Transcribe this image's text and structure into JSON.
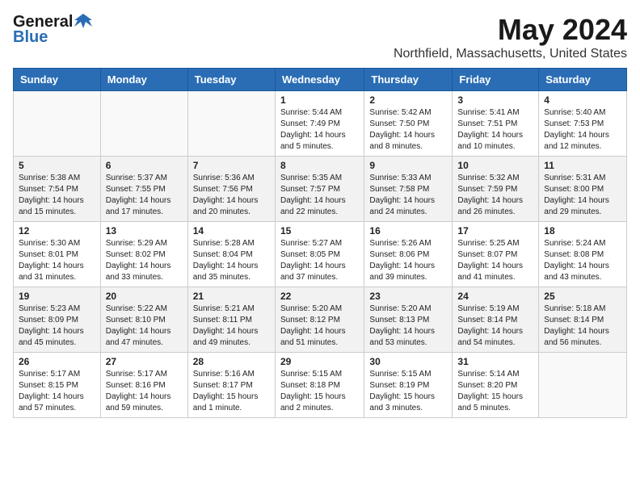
{
  "header": {
    "logo_general": "General",
    "logo_blue": "Blue",
    "month_title": "May 2024",
    "location": "Northfield, Massachusetts, United States"
  },
  "weekdays": [
    "Sunday",
    "Monday",
    "Tuesday",
    "Wednesday",
    "Thursday",
    "Friday",
    "Saturday"
  ],
  "weeks": [
    [
      {
        "day": "",
        "info": ""
      },
      {
        "day": "",
        "info": ""
      },
      {
        "day": "",
        "info": ""
      },
      {
        "day": "1",
        "info": "Sunrise: 5:44 AM\nSunset: 7:49 PM\nDaylight: 14 hours\nand 5 minutes."
      },
      {
        "day": "2",
        "info": "Sunrise: 5:42 AM\nSunset: 7:50 PM\nDaylight: 14 hours\nand 8 minutes."
      },
      {
        "day": "3",
        "info": "Sunrise: 5:41 AM\nSunset: 7:51 PM\nDaylight: 14 hours\nand 10 minutes."
      },
      {
        "day": "4",
        "info": "Sunrise: 5:40 AM\nSunset: 7:53 PM\nDaylight: 14 hours\nand 12 minutes."
      }
    ],
    [
      {
        "day": "5",
        "info": "Sunrise: 5:38 AM\nSunset: 7:54 PM\nDaylight: 14 hours\nand 15 minutes."
      },
      {
        "day": "6",
        "info": "Sunrise: 5:37 AM\nSunset: 7:55 PM\nDaylight: 14 hours\nand 17 minutes."
      },
      {
        "day": "7",
        "info": "Sunrise: 5:36 AM\nSunset: 7:56 PM\nDaylight: 14 hours\nand 20 minutes."
      },
      {
        "day": "8",
        "info": "Sunrise: 5:35 AM\nSunset: 7:57 PM\nDaylight: 14 hours\nand 22 minutes."
      },
      {
        "day": "9",
        "info": "Sunrise: 5:33 AM\nSunset: 7:58 PM\nDaylight: 14 hours\nand 24 minutes."
      },
      {
        "day": "10",
        "info": "Sunrise: 5:32 AM\nSunset: 7:59 PM\nDaylight: 14 hours\nand 26 minutes."
      },
      {
        "day": "11",
        "info": "Sunrise: 5:31 AM\nSunset: 8:00 PM\nDaylight: 14 hours\nand 29 minutes."
      }
    ],
    [
      {
        "day": "12",
        "info": "Sunrise: 5:30 AM\nSunset: 8:01 PM\nDaylight: 14 hours\nand 31 minutes."
      },
      {
        "day": "13",
        "info": "Sunrise: 5:29 AM\nSunset: 8:02 PM\nDaylight: 14 hours\nand 33 minutes."
      },
      {
        "day": "14",
        "info": "Sunrise: 5:28 AM\nSunset: 8:04 PM\nDaylight: 14 hours\nand 35 minutes."
      },
      {
        "day": "15",
        "info": "Sunrise: 5:27 AM\nSunset: 8:05 PM\nDaylight: 14 hours\nand 37 minutes."
      },
      {
        "day": "16",
        "info": "Sunrise: 5:26 AM\nSunset: 8:06 PM\nDaylight: 14 hours\nand 39 minutes."
      },
      {
        "day": "17",
        "info": "Sunrise: 5:25 AM\nSunset: 8:07 PM\nDaylight: 14 hours\nand 41 minutes."
      },
      {
        "day": "18",
        "info": "Sunrise: 5:24 AM\nSunset: 8:08 PM\nDaylight: 14 hours\nand 43 minutes."
      }
    ],
    [
      {
        "day": "19",
        "info": "Sunrise: 5:23 AM\nSunset: 8:09 PM\nDaylight: 14 hours\nand 45 minutes."
      },
      {
        "day": "20",
        "info": "Sunrise: 5:22 AM\nSunset: 8:10 PM\nDaylight: 14 hours\nand 47 minutes."
      },
      {
        "day": "21",
        "info": "Sunrise: 5:21 AM\nSunset: 8:11 PM\nDaylight: 14 hours\nand 49 minutes."
      },
      {
        "day": "22",
        "info": "Sunrise: 5:20 AM\nSunset: 8:12 PM\nDaylight: 14 hours\nand 51 minutes."
      },
      {
        "day": "23",
        "info": "Sunrise: 5:20 AM\nSunset: 8:13 PM\nDaylight: 14 hours\nand 53 minutes."
      },
      {
        "day": "24",
        "info": "Sunrise: 5:19 AM\nSunset: 8:14 PM\nDaylight: 14 hours\nand 54 minutes."
      },
      {
        "day": "25",
        "info": "Sunrise: 5:18 AM\nSunset: 8:14 PM\nDaylight: 14 hours\nand 56 minutes."
      }
    ],
    [
      {
        "day": "26",
        "info": "Sunrise: 5:17 AM\nSunset: 8:15 PM\nDaylight: 14 hours\nand 57 minutes."
      },
      {
        "day": "27",
        "info": "Sunrise: 5:17 AM\nSunset: 8:16 PM\nDaylight: 14 hours\nand 59 minutes."
      },
      {
        "day": "28",
        "info": "Sunrise: 5:16 AM\nSunset: 8:17 PM\nDaylight: 15 hours\nand 1 minute."
      },
      {
        "day": "29",
        "info": "Sunrise: 5:15 AM\nSunset: 8:18 PM\nDaylight: 15 hours\nand 2 minutes."
      },
      {
        "day": "30",
        "info": "Sunrise: 5:15 AM\nSunset: 8:19 PM\nDaylight: 15 hours\nand 3 minutes."
      },
      {
        "day": "31",
        "info": "Sunrise: 5:14 AM\nSunset: 8:20 PM\nDaylight: 15 hours\nand 5 minutes."
      },
      {
        "day": "",
        "info": ""
      }
    ]
  ]
}
